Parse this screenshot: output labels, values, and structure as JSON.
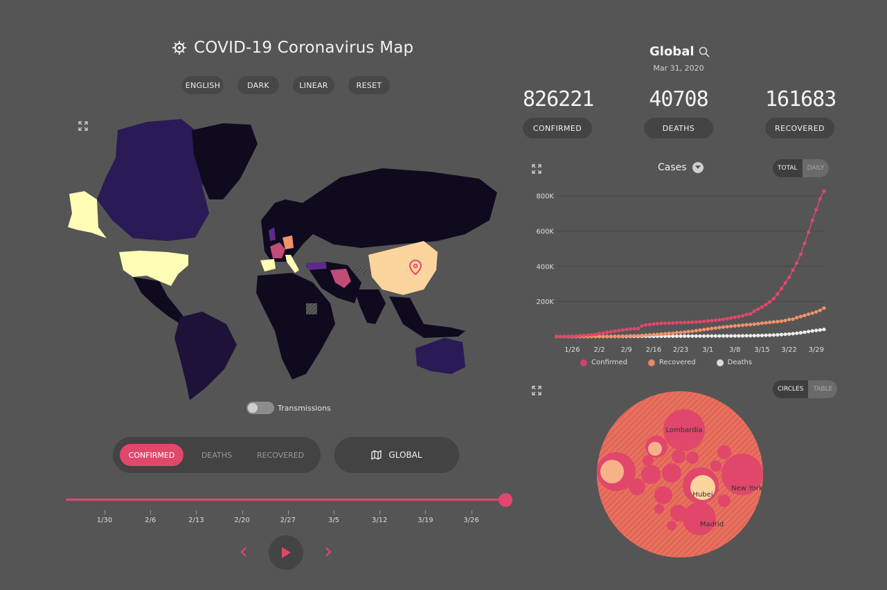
{
  "header": {
    "title": "COVID-19 Coronavirus Map",
    "buttons": [
      "ENGLISH",
      "DARK",
      "LINEAR",
      "RESET"
    ]
  },
  "map": {
    "transmissions_label": "Transmissions",
    "transmissions_on": false,
    "metric_tabs": [
      "CONFIRMED",
      "DEATHS",
      "RECOVERED"
    ],
    "active_metric": "CONFIRMED",
    "region_button": "GLOBAL"
  },
  "timeline": {
    "ticks": [
      "1/30",
      "2/6",
      "2/13",
      "2/20",
      "2/27",
      "3/5",
      "3/12",
      "3/19",
      "3/26"
    ],
    "progress": 1.0
  },
  "summary": {
    "region": "Global",
    "date": "Mar 31, 2020",
    "stats": [
      {
        "value": "826221",
        "label": "CONFIRMED"
      },
      {
        "value": "40708",
        "label": "DEATHS"
      },
      {
        "value": "161683",
        "label": "RECOVERED"
      }
    ]
  },
  "cases_panel": {
    "title": "Cases",
    "toggle": [
      "TOTAL",
      "DAILY"
    ],
    "active_toggle": "TOTAL"
  },
  "bubble_panel": {
    "toggle": [
      "CIRCLES",
      "TABLE"
    ],
    "active_toggle": "CIRCLES",
    "labels": [
      "Lombardia",
      "Hubei",
      "New York",
      "Madrid"
    ]
  },
  "colors": {
    "background": "#555555",
    "confirmed": "#e0476b",
    "recovered": "#f0926a",
    "deaths": "#eeeeee",
    "bubble": "#e8705f"
  },
  "chart_data": {
    "type": "line",
    "x_tick_labels": [
      "1/26",
      "2/2",
      "2/9",
      "2/16",
      "2/23",
      "3/1",
      "3/8",
      "3/15",
      "3/22",
      "3/29"
    ],
    "y_tick_labels": [
      "200K",
      "400K",
      "600K",
      "800K"
    ],
    "ylim": [
      0,
      850000
    ],
    "x_start": "1/22",
    "series": [
      {
        "name": "Confirmed",
        "color": "#e0476b",
        "values": [
          555,
          654,
          941,
          1434,
          2118,
          2927,
          5578,
          6166,
          8234,
          9927,
          12038,
          16787,
          19881,
          23892,
          27635,
          30817,
          34391,
          37120,
          40150,
          42762,
          44802,
          45221,
          60368,
          66885,
          69030,
          71224,
          73258,
          75136,
          75639,
          76197,
          76819,
          78572,
          78958,
          79561,
          80406,
          81388,
          82746,
          84112,
          86011,
          88369,
          90306,
          92840,
          95120,
          97886,
          101801,
          105847,
          109821,
          113590,
          118620,
          125875,
          128352,
          145205,
          156101,
          167454,
          181574,
          197102,
          214821,
          242570,
          272208,
          304507,
          336953,
          378235,
          418045,
          467653,
          529591,
          593291,
          660706,
          720117,
          782365,
          826221
        ]
      },
      {
        "name": "Recovered",
        "color": "#f0926a",
        "values": [
          28,
          30,
          36,
          39,
          52,
          61,
          107,
          126,
          143,
          222,
          284,
          472,
          623,
          852,
          1124,
          1487,
          2011,
          2616,
          3244,
          3946,
          4683,
          5150,
          6295,
          8058,
          9395,
          10865,
          12583,
          14352,
          16121,
          18177,
          18890,
          22886,
          23394,
          25227,
          27905,
          30384,
          33277,
          36711,
          39782,
          42716,
          45602,
          48228,
          51170,
          53796,
          55865,
          58358,
          60694,
          62494,
          64404,
          67003,
          68324,
          70251,
          72624,
          76034,
          78088,
          80840,
          83207,
          84854,
          87256,
          91399,
          97243,
          98334,
          108000,
          114000,
          120000,
          127000,
          133000,
          140000,
          149000,
          161683
        ]
      },
      {
        "name": "Deaths",
        "color": "#eeeeee",
        "values": [
          17,
          18,
          26,
          42,
          56,
          82,
          131,
          133,
          171,
          213,
          259,
          362,
          426,
          492,
          564,
          634,
          719,
          806,
          906,
          1013,
          1113,
          1118,
          1371,
          1523,
          1666,
          1770,
          1868,
          2007,
          2122,
          2247,
          2251,
          2458,
          2469,
          2629,
          2708,
          2770,
          2814,
          2872,
          2941,
          2996,
          3085,
          3160,
          3254,
          3348,
          3460,
          3558,
          3802,
          3988,
          4262,
          4615,
          4720,
          5404,
          5819,
          6440,
          7126,
          7905,
          8733,
          9867,
          11299,
          13017,
          14755,
          16558,
          18966,
          21818,
          24814,
          28286,
          31700,
          35000,
          37500,
          40708
        ]
      }
    ]
  }
}
